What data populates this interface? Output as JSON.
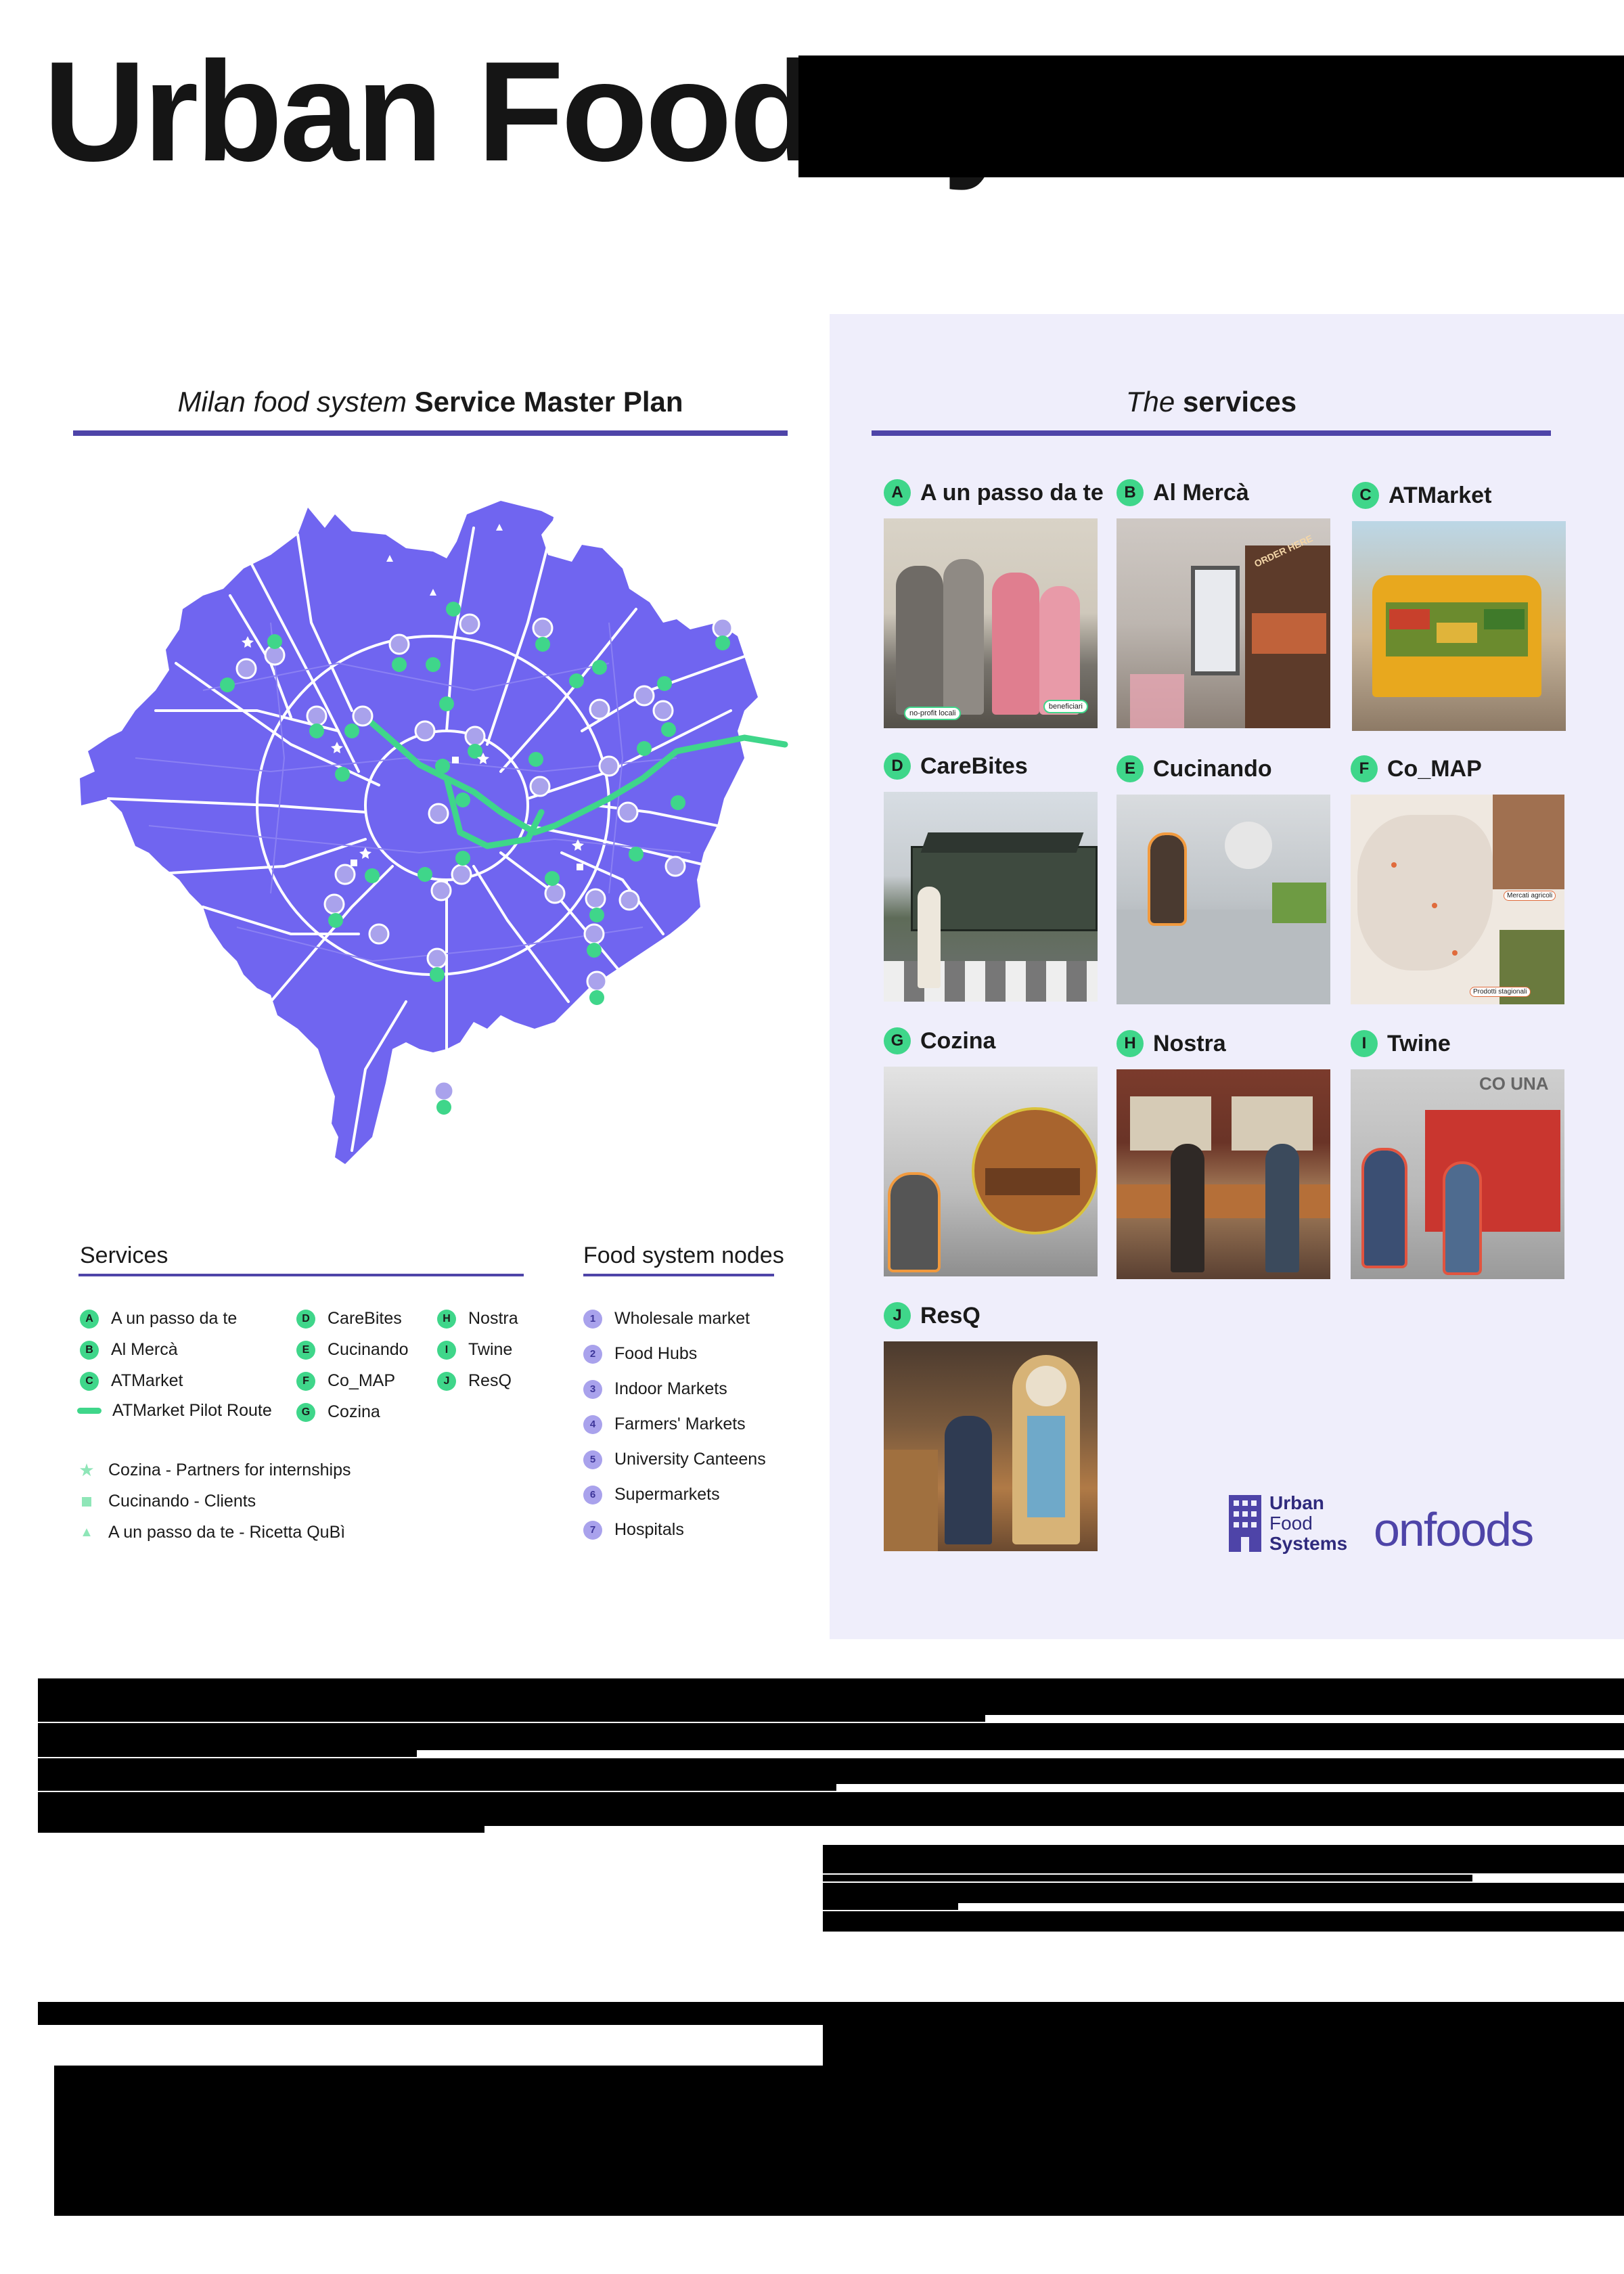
{
  "title": "Urban Food Systems",
  "map_section": {
    "heading_italic": "Milan food system",
    "heading_bold": "Service Master Plan"
  },
  "services_section": {
    "heading_italic": "The",
    "heading_bold": "services"
  },
  "services": [
    {
      "letter": "A",
      "name": "A un passo da te",
      "photo_label_1": "no-profit locali",
      "photo_label_2": "beneficiari"
    },
    {
      "letter": "B",
      "name": "Al Mercà",
      "photo_label_1": "ORDER HERE"
    },
    {
      "letter": "C",
      "name": "ATMarket"
    },
    {
      "letter": "D",
      "name": "CareBites"
    },
    {
      "letter": "E",
      "name": "Cucinando"
    },
    {
      "letter": "F",
      "name": "Co_MAP",
      "photo_label_1": "Mercati agricoli",
      "photo_label_2": "Prodotti stagionali"
    },
    {
      "letter": "G",
      "name": "Cozina"
    },
    {
      "letter": "H",
      "name": "Nostra"
    },
    {
      "letter": "I",
      "name": "Twine",
      "photo_label_1": "CO UNA"
    },
    {
      "letter": "J",
      "name": "ResQ"
    }
  ],
  "legend": {
    "services_title": "Services",
    "services": [
      {
        "letter": "A",
        "label": "A un passo da te"
      },
      {
        "letter": "B",
        "label": "Al Mercà"
      },
      {
        "letter": "C",
        "label": "ATMarket"
      },
      {
        "letter": "D",
        "label": "CareBites"
      },
      {
        "letter": "E",
        "label": "Cucinando"
      },
      {
        "letter": "F",
        "label": "Co_MAP"
      },
      {
        "letter": "G",
        "label": "Cozina"
      },
      {
        "letter": "H",
        "label": "Nostra"
      },
      {
        "letter": "I",
        "label": "Twine"
      },
      {
        "letter": "J",
        "label": "ResQ"
      }
    ],
    "route_label": "ATMarket Pilot Route",
    "symbols": [
      {
        "icon": "star-icon",
        "label": "Cozina - Partners for internships"
      },
      {
        "icon": "square-icon",
        "label": "Cucinando - Clients"
      },
      {
        "icon": "triangle-icon",
        "label": "A un passo da te - Ricetta QuBì"
      }
    ],
    "nodes_title": "Food system nodes",
    "nodes": [
      {
        "num": "1",
        "label": "Wholesale market"
      },
      {
        "num": "2",
        "label": "Food Hubs"
      },
      {
        "num": "3",
        "label": "Indoor Markets"
      },
      {
        "num": "4",
        "label": "Farmers' Markets"
      },
      {
        "num": "5",
        "label": "University Canteens"
      },
      {
        "num": "6",
        "label": "Supermarkets"
      },
      {
        "num": "7",
        "label": "Hospitals"
      }
    ]
  },
  "logos": {
    "ufs_line1": "Urban",
    "ufs_line2": "Food",
    "ufs_line3": "Systems",
    "onfoods": "onfoods"
  },
  "colors": {
    "map_fill": "#7065f0",
    "accent": "#4e44a8",
    "service_green": "#3fd68a",
    "node_lilac": "#a9a2ec",
    "panel_bg": "#efeefb"
  }
}
